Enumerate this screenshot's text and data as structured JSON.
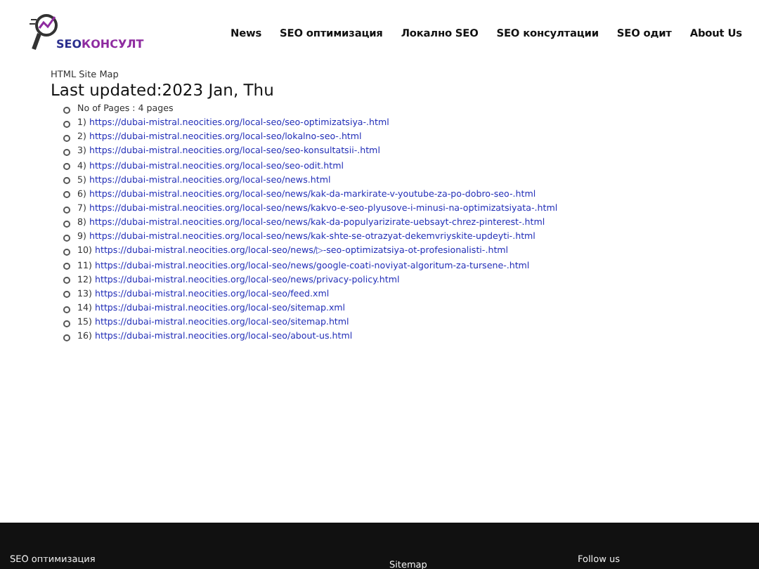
{
  "logo": {
    "part_1": "SEO",
    "part_2": "КОНСУЛТ"
  },
  "nav": [
    {
      "label": "News"
    },
    {
      "label": "SEO оптимизация"
    },
    {
      "label": "Локално SEO"
    },
    {
      "label": "SEO консултации"
    },
    {
      "label": "SEO одит"
    },
    {
      "label": "About Us"
    }
  ],
  "sitemap": {
    "heading": "HTML Site Map",
    "updated": "Last updated:2023 Jan, Thu",
    "count": "No of Pages : 4 pages",
    "links": [
      {
        "number": "1)",
        "url": "https://dubai-mistral.neocities.org/local-seo/seo-optimizatsiya-.html"
      },
      {
        "number": "2)",
        "url": "https://dubai-mistral.neocities.org/local-seo/lokalno-seo-.html"
      },
      {
        "number": "3)",
        "url": "https://dubai-mistral.neocities.org/local-seo/seo-konsultatsii-.html"
      },
      {
        "number": "4)",
        "url": "https://dubai-mistral.neocities.org/local-seo/seo-odit.html"
      },
      {
        "number": "5)",
        "url": "https://dubai-mistral.neocities.org/local-seo/news.html"
      },
      {
        "number": "6)",
        "url": "https://dubai-mistral.neocities.org/local-seo/news/kak-da-markirate-v-youtube-za-po-dobro-seo-.html"
      },
      {
        "number": "7)",
        "url": "https://dubai-mistral.neocities.org/local-seo/news/kakvo-e-seo-plyusove-i-minusi-na-optimizatsiyata-.html"
      },
      {
        "number": "8)",
        "url": "https://dubai-mistral.neocities.org/local-seo/news/kak-da-populyarizirate-uebsayt-chrez-pinterest-.html"
      },
      {
        "number": "9)",
        "url": "https://dubai-mistral.neocities.org/local-seo/news/kak-shte-se-otrazyat-dekemvriyskite-updeyti-.html"
      },
      {
        "number": "10)",
        "url": "https://dubai-mistral.neocities.org/local-seo/news/▷-seo-optimizatsiya-ot-profesionalisti-.html"
      },
      {
        "number": "11)",
        "url": "https://dubai-mistral.neocities.org/local-seo/news/google-coati-noviyat-algoritum-za-tursene-.html"
      },
      {
        "number": "12)",
        "url": "https://dubai-mistral.neocities.org/local-seo/news/privacy-policy.html"
      },
      {
        "number": "13)",
        "url": "https://dubai-mistral.neocities.org/local-seo/feed.xml"
      },
      {
        "number": "14)",
        "url": "https://dubai-mistral.neocities.org/local-seo/sitemap.xml"
      },
      {
        "number": "15)",
        "url": "https://dubai-mistral.neocities.org/local-seo/sitemap.html"
      },
      {
        "number": "16)",
        "url": "https://dubai-mistral.neocities.org/local-seo/about-us.html"
      }
    ]
  },
  "footer": {
    "column_1": "SEO оптимизация",
    "column_2": "Sitemap",
    "column_3": "Follow us"
  }
}
